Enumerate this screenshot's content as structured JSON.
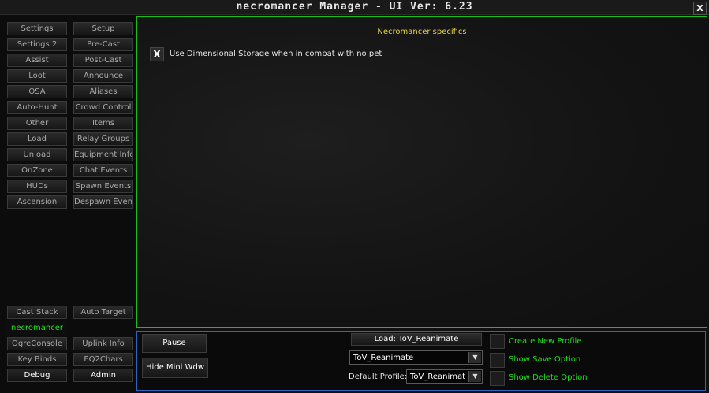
{
  "window": {
    "title": "necromancer Manager  - UI Ver: 6.23",
    "close_label": "X"
  },
  "sidebar": {
    "left_col": [
      "Settings",
      "Settings 2",
      "Assist",
      "Loot",
      "OSA",
      "Auto-Hunt",
      "Other",
      "Load",
      "Unload",
      "OnZone",
      "HUDs",
      "Ascension"
    ],
    "right_col": [
      "Setup",
      "Pre-Cast",
      "Post-Cast",
      "Announce",
      "Aliases",
      "Crowd Control",
      "Items",
      "Relay Groups",
      "Equipment Info",
      "Chat Events",
      "Spawn Events",
      "Despawn Event"
    ],
    "bottom": {
      "cast_stack": "Cast Stack",
      "auto_target": "Auto Target",
      "class_tab": "necromancer",
      "ogre_console": "OgreConsole",
      "uplink_info": "Uplink Info",
      "key_binds": "Key Binds",
      "eq2chars": "EQ2Chars",
      "debug": "Debug",
      "admin": "Admin"
    }
  },
  "content": {
    "title": "Necromancer specifics",
    "option": {
      "checked_mark": "X",
      "label": "Use Dimensional Storage when in combat with no pet"
    }
  },
  "bottom_panel": {
    "pause": "Pause",
    "hide_mini": "Hide Mini Wdw",
    "load_button": "Load: ToV_Reanimate",
    "profile_select": "ToV_Reanimate",
    "default_profile_label": "Default Profile:",
    "default_profile_value": "ToV_Reanimat",
    "create_profile": "Create New Profile",
    "show_save": "Show Save Option",
    "show_delete": "Show Delete Option",
    "dropdown_arrow": "▼"
  },
  "colors": {
    "accent_green": "#22dd22",
    "title_yellow": "#e8d44a",
    "panel_border_green": "#18c018",
    "panel_border_blue": "#2b66c0"
  }
}
